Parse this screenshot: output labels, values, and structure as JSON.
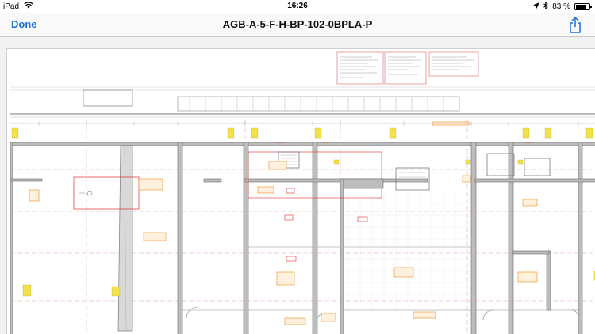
{
  "status_bar": {
    "device": "iPad",
    "time": "16:26",
    "battery": "83 %",
    "battery_level": 0.83
  },
  "nav": {
    "done_label": "Done",
    "title": "AGB-A-5-F-H-BP-102-0BPLA-P"
  },
  "icons": {
    "wifi": "wifi-icon",
    "location": "location-arrow-icon",
    "bluetooth": "bluetooth-icon",
    "battery": "battery-icon",
    "share": "share-icon"
  },
  "colors": {
    "accent": "#1a73d9",
    "drawing_red": "#d93030",
    "drawing_orange": "#f08a1c",
    "drawing_yellow": "#f1e24a"
  }
}
